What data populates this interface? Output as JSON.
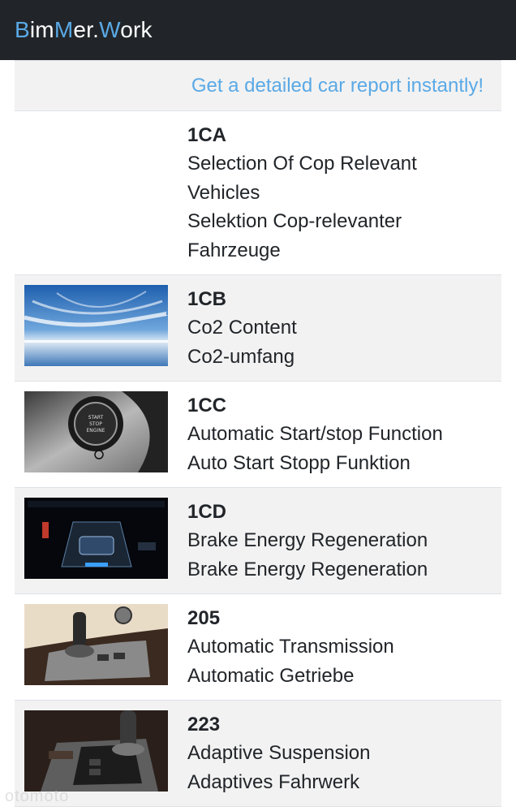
{
  "header": {
    "brand_parts": [
      {
        "text": "B",
        "accent": true
      },
      {
        "text": "im",
        "accent": false
      },
      {
        "text": "M",
        "accent": true
      },
      {
        "text": "er.",
        "accent": false
      },
      {
        "text": "W",
        "accent": true
      },
      {
        "text": "ork",
        "accent": false
      }
    ]
  },
  "banner": {
    "link_text": "Get a detailed car report instantly!"
  },
  "options": [
    {
      "code": "1CA",
      "lines": [
        "Selection Of Cop Relevant",
        "Vehicles",
        "Selektion Cop-relevanter",
        "Fahrzeuge"
      ],
      "image": "none"
    },
    {
      "code": "1CB",
      "lines": [
        "Co2 Content",
        "Co2-umfang"
      ],
      "image": "sky-clouds-image"
    },
    {
      "code": "1CC",
      "lines": [
        "Automatic Start/stop Function",
        "Auto Start Stopp Funktion"
      ],
      "image": "start-stop-button-image"
    },
    {
      "code": "1CD",
      "lines": [
        "Brake Energy Regeneration",
        "Brake Energy Regeneration"
      ],
      "image": "instrument-display-image"
    },
    {
      "code": "205",
      "lines": [
        "Automatic Transmission",
        "Automatic Getriebe"
      ],
      "image": "gear-selector-image"
    },
    {
      "code": "223",
      "lines": [
        "Adaptive Suspension",
        "Adaptives Fahrwerk"
      ],
      "image": "center-console-image"
    }
  ],
  "watermark": "otomoto",
  "colors": {
    "navbar": "#212529",
    "accent": "#5aa9e6",
    "stripe": "#f2f2f2"
  }
}
